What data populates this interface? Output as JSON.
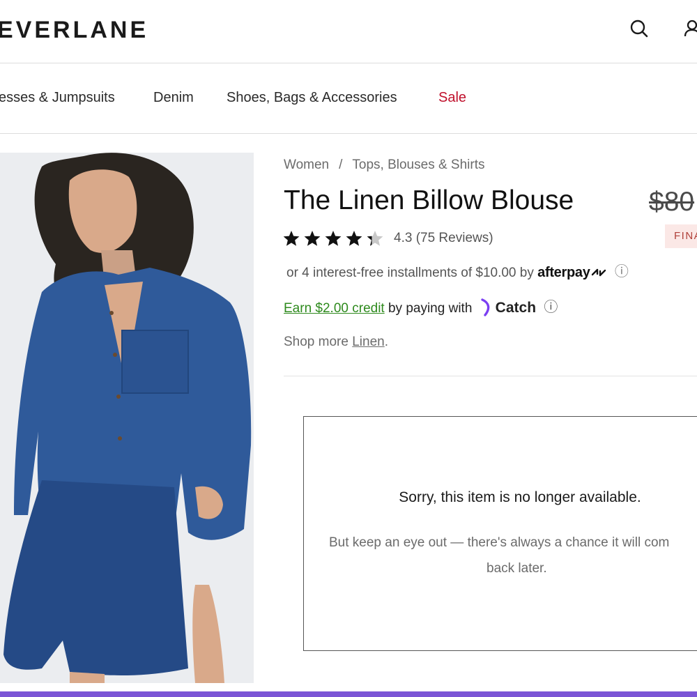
{
  "header": {
    "logo": "EVERLANE",
    "search_icon": "search-icon",
    "account_icon": "account-icon"
  },
  "nav": {
    "items": [
      {
        "label": "esses & Jumpsuits"
      },
      {
        "label": "Denim"
      },
      {
        "label": "Shoes, Bags & Accessories"
      },
      {
        "label": "Sale"
      }
    ],
    "sale_color": "#c0102c"
  },
  "product": {
    "breadcrumb": [
      "Women",
      "Tops, Blouses & Shirts"
    ],
    "breadcrumb_separator": "/",
    "title": "The Linen Billow Blouse",
    "original_price": "$80",
    "badge": "FINAL SALE",
    "rating_value": 4.3,
    "rating_text": "4.3 (75 Reviews)",
    "installments_text": "or 4 interest-free installments of $10.00 by",
    "afterpay_brand": "afterpay",
    "earn_credit": "Earn $2.00 credit",
    "paying_with": "by paying with",
    "catch_brand": "Catch",
    "shop_more_prefix": "Shop more",
    "shop_more_link": "Linen",
    "shop_more_suffix": ".",
    "info_icon": "ⓘ"
  },
  "unavailable": {
    "title": "Sorry, this item is no longer available.",
    "body_line1": "But keep an eye out — there's always a chance it will com",
    "body_line2": "back later."
  },
  "colors": {
    "accent_green": "#2e8a1d",
    "badge_bg": "#fbe8e6",
    "badge_text": "#b0413a",
    "catch_purple": "#7b3ff2",
    "bottom_bar": "#7b55d6"
  }
}
